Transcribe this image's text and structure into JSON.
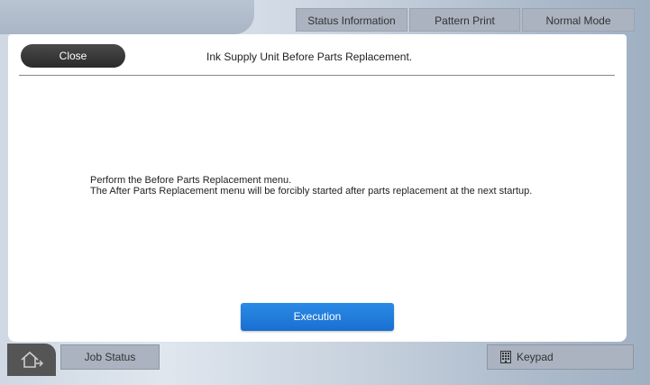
{
  "top_bar": {
    "tabs": [
      {
        "label": "Status Information"
      },
      {
        "label": "Pattern Print"
      },
      {
        "label": "Normal Mode"
      }
    ]
  },
  "dialog": {
    "close_label": "Close",
    "title": "Ink Supply Unit Before Parts Replacement.",
    "message_line1": "Perform the Before Parts Replacement menu.",
    "message_line2": "The After Parts Replacement menu will be forcibly started after parts replacement at the next startup.",
    "execute_label": "Execution"
  },
  "bottom_bar": {
    "home_icon": "home-icon",
    "job_status_label": "Job Status",
    "keypad_label": "Keypad",
    "keypad_icon": "keypad-icon"
  },
  "colors": {
    "accent": "#1f7ad9",
    "close_button": "#333333",
    "tab_bg": "#aab3bf"
  }
}
